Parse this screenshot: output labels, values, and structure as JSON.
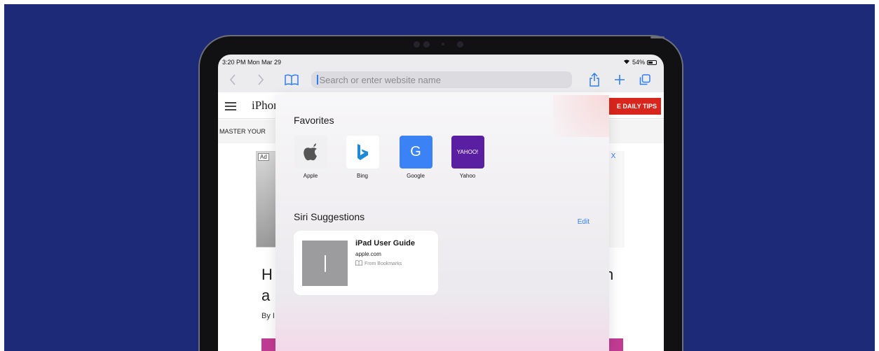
{
  "status_bar": {
    "time": "3:20 PM  Mon Mar 29",
    "battery": "54%"
  },
  "toolbar": {
    "address_placeholder": "Search or enter website name"
  },
  "background_page": {
    "logo_text": "iPhon",
    "tips_button": "E DAILY TIPS",
    "subnav_text": "MASTER YOUR",
    "ad_label": "Ad",
    "ad_close": "> X",
    "headline_left_1": "H",
    "headline_left_2": "a",
    "headline_right": "n",
    "byline": "By I"
  },
  "favorites": {
    "title": "Favorites",
    "items": [
      {
        "label": "Apple",
        "icon": "apple-icon",
        "color": "#f0f0f2"
      },
      {
        "label": "Bing",
        "icon": "bing-icon",
        "color": "#ffffff"
      },
      {
        "label": "Google",
        "icon": "google-icon",
        "color": "#3b82f6",
        "glyph": "G"
      },
      {
        "label": "Yahoo",
        "icon": "yahoo-icon",
        "color": "#5a1ea3",
        "glyph": "YAHOO!"
      }
    ]
  },
  "siri_suggestions": {
    "title": "Siri Suggestions",
    "edit_label": "Edit",
    "card": {
      "title": "iPad User Guide",
      "domain": "apple.com",
      "source": "From Bookmarks"
    }
  },
  "colors": {
    "background": "#1c2a78",
    "accent": "#2f7df6",
    "tips_red": "#d9261c"
  }
}
